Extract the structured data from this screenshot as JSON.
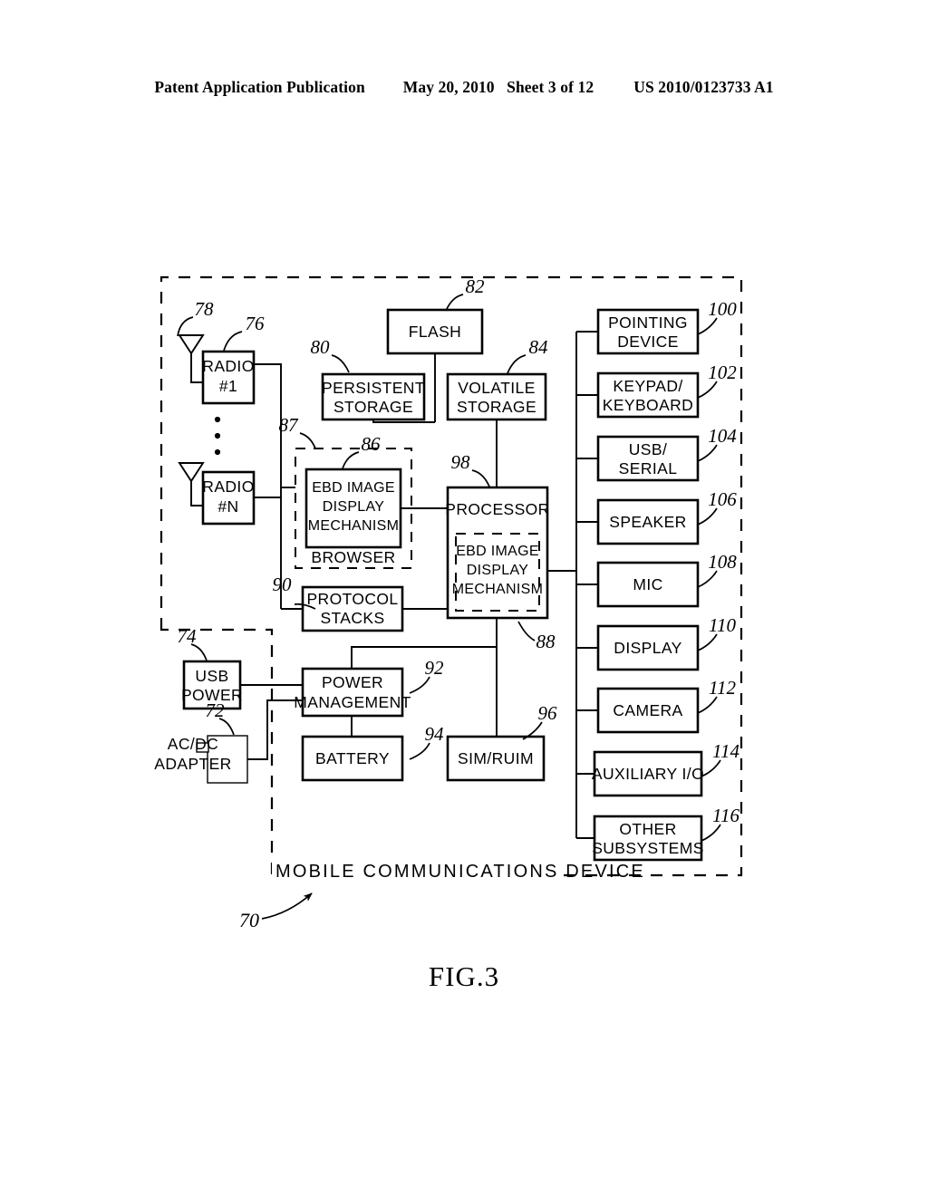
{
  "header": {
    "publication": "Patent Application Publication",
    "date": "May 20, 2010",
    "sheet": "Sheet 3 of 12",
    "patent_number": "US 2010/0123733 A1"
  },
  "figure": {
    "caption": "FIG.3",
    "device_label": "MOBILE COMMUNICATIONS DEVICE",
    "device_ref": "70"
  },
  "blocks": {
    "radio1": {
      "line1": "RADIO",
      "line2": "#1",
      "ref": "76"
    },
    "radioN": {
      "line1": "RADIO",
      "line2": "#N",
      "ref": ""
    },
    "antenna1": {
      "ref": "78"
    },
    "antennaN": {
      "ref": ""
    },
    "flash": {
      "line1": "FLASH",
      "ref": "82"
    },
    "persistent_storage": {
      "line1": "PERSISTENT",
      "line2": "STORAGE",
      "ref": "80"
    },
    "volatile_storage": {
      "line1": "VOLATILE",
      "line2": "STORAGE",
      "ref": "84"
    },
    "browser": {
      "label": "BROWSER",
      "ref": "87"
    },
    "ebd_browser": {
      "line1": "EBD IMAGE",
      "line2": "DISPLAY",
      "line3": "MECHANISM",
      "ref": "86"
    },
    "protocol_stacks": {
      "line1": "PROTOCOL",
      "line2": "STACKS",
      "ref": "90"
    },
    "processor": {
      "label": "PROCESSOR",
      "ref": "98"
    },
    "ebd_processor": {
      "line1": "EBD IMAGE",
      "line2": "DISPLAY",
      "line3": "MECHANISM",
      "ref": "88"
    },
    "usb_power": {
      "line1": "USB",
      "line2": "POWER",
      "ref": "74"
    },
    "acdc_adapter": {
      "line1": "AC/DC",
      "line2": "ADAPTER",
      "ref": "72"
    },
    "power_management": {
      "line1": "POWER",
      "line2": "MANAGEMENT",
      "ref": "92"
    },
    "battery": {
      "line1": "BATTERY",
      "ref": "94"
    },
    "sim_ruim": {
      "line1": "SIM/RUIM",
      "ref": "96"
    }
  },
  "peripherals": [
    {
      "line1": "POINTING",
      "line2": "DEVICE",
      "ref": "100"
    },
    {
      "line1": "KEYPAD/",
      "line2": "KEYBOARD",
      "ref": "102"
    },
    {
      "line1": "USB/",
      "line2": "SERIAL",
      "ref": "104"
    },
    {
      "line1": "SPEAKER",
      "line2": "",
      "ref": "106"
    },
    {
      "line1": "MIC",
      "line2": "",
      "ref": "108"
    },
    {
      "line1": "DISPLAY",
      "line2": "",
      "ref": "110"
    },
    {
      "line1": "CAMERA",
      "line2": "",
      "ref": "112"
    },
    {
      "line1": "AUXILIARY I/O",
      "line2": "",
      "ref": "114"
    },
    {
      "line1": "OTHER",
      "line2": "SUBSYSTEMS",
      "ref": "116"
    }
  ],
  "colors": {
    "ink": "#000000",
    "paper": "#ffffff"
  }
}
